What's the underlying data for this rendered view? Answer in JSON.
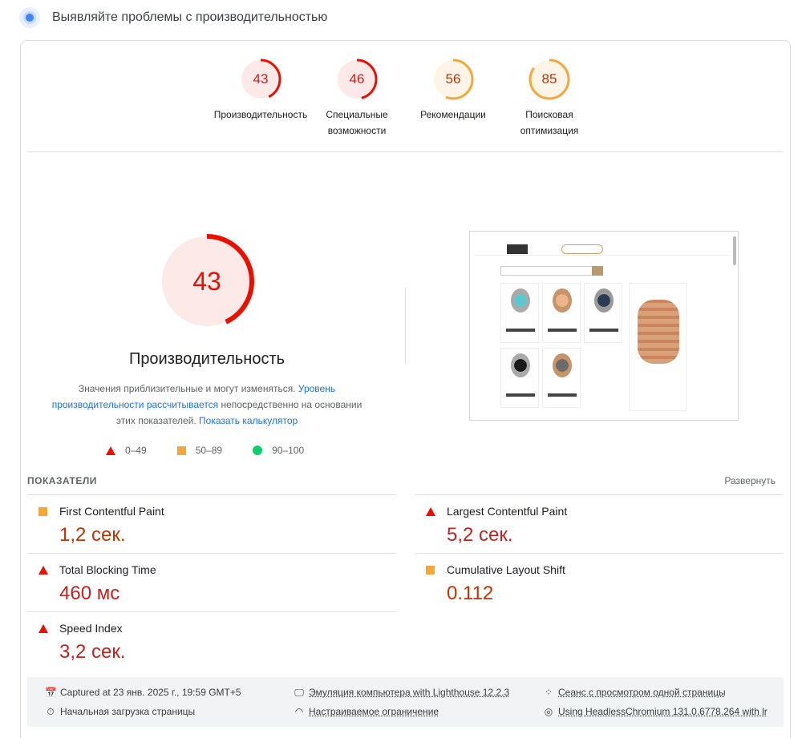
{
  "header": {
    "title": "Выявляйте проблемы с производительностью"
  },
  "categories": [
    {
      "score": 43,
      "label_line1": "Производительность",
      "label_line2": "",
      "color": "#eb0f00",
      "fill": "#fde9e8",
      "fraction": 0.43
    },
    {
      "score": 46,
      "label_line1": "Специальные",
      "label_line2": "возможности",
      "color": "#eb0f00",
      "fill": "#fde9e8",
      "fraction": 0.46
    },
    {
      "score": 56,
      "label_line1": "Рекомендации",
      "label_line2": "",
      "color": "#f4a83a",
      "fill": "#fef4e7",
      "fraction": 0.56
    },
    {
      "score": 85,
      "label_line1": "Поисковая",
      "label_line2": "оптимизация",
      "color": "#f4a83a",
      "fill": "#fef4e7",
      "fraction": 0.85
    }
  ],
  "main": {
    "score": 43,
    "fraction": 0.43,
    "title": "Производительность",
    "desc_part1": "Значения приблизительные и могут изменяться. ",
    "desc_link1": "Уровень производительности рассчитывается",
    "desc_part2": " непосредственно на основании этих показателей. ",
    "desc_link2": "Показать калькулятор"
  },
  "legend": {
    "poor": "0–49",
    "average": "50–89",
    "good": "90–100"
  },
  "metrics": {
    "header": "ПОКАЗАТЕЛИ",
    "expand": "Развернуть",
    "items": [
      {
        "name": "First Contentful Paint",
        "value": "1,2 сек.",
        "status": "average"
      },
      {
        "name": "Largest Contentful Paint",
        "value": "5,2 сек.",
        "status": "poor"
      },
      {
        "name": "Total Blocking Time",
        "value": "460 мс",
        "status": "poor"
      },
      {
        "name": "Cumulative Layout Shift",
        "value": "0.112",
        "status": "average"
      },
      {
        "name": "Speed Index",
        "value": "3,2 сек.",
        "status": "poor"
      }
    ]
  },
  "footer": {
    "captured": "Captured at 23 янв. 2025 г., 19:59 GMT+5",
    "emulation": "Эмуляция компьютера with Lighthouse 12.2.3",
    "session": "Сеанс с просмотром одной страницы",
    "load": "Начальная загрузка страницы",
    "throttling": "Настраиваемое ограничение",
    "browser": "Using HeadlessChromium 131.0.6778.264 with lr"
  }
}
